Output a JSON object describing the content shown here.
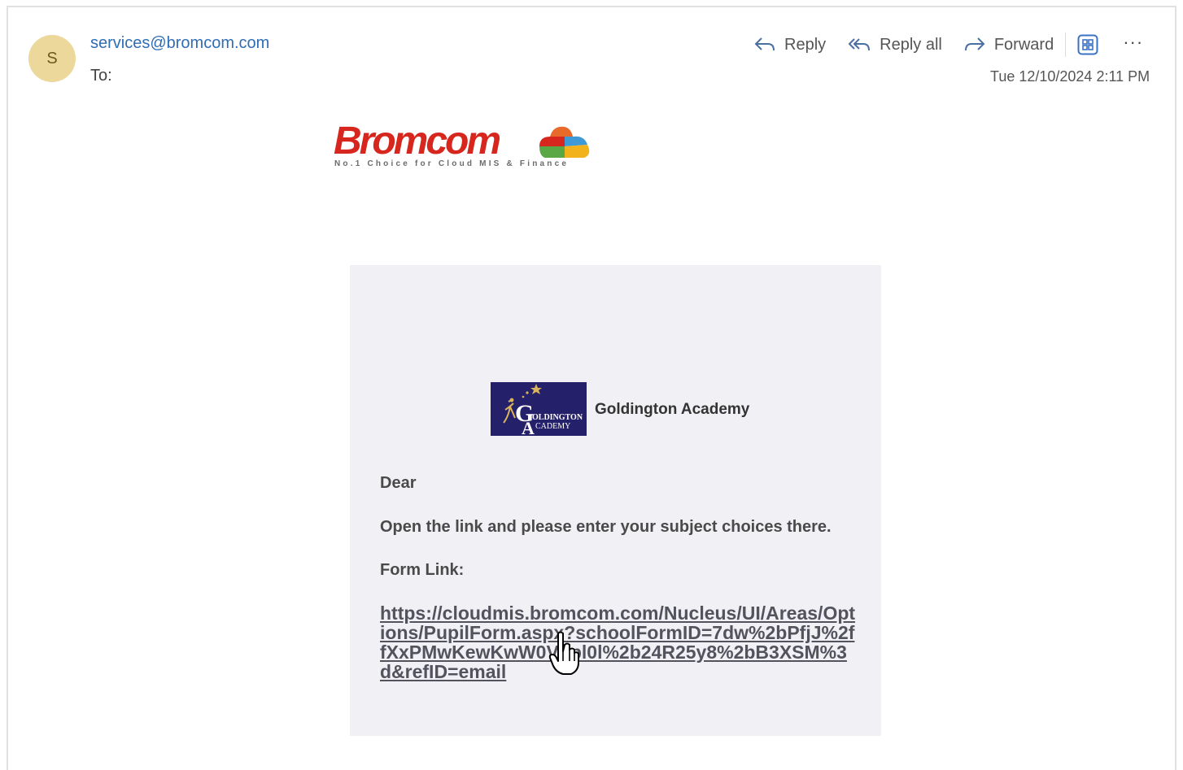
{
  "header": {
    "avatar_initial": "S",
    "sender": "services@bromcom.com",
    "to_label": "To:",
    "date": "Tue 12/10/2024 2:11 PM"
  },
  "actions": {
    "reply": "Reply",
    "reply_all": "Reply all",
    "forward": "Forward",
    "more": "···"
  },
  "logo": {
    "word": "Bromcom",
    "tagline": "No.1 Choice for Cloud MIS & Finance"
  },
  "school": {
    "logo_text": "GOLDINGTON ACADEMY",
    "name": "Goldington Academy"
  },
  "email_body": {
    "greeting": "Dear",
    "message": "Open the link and please enter your subject choices there.",
    "form_link_label": "Form Link:",
    "link": "https://cloudmis.bromcom.com/Nucleus/UI/Areas/Options/PupilForm.aspx?schoolFormID=7dw%2bPfjJ%2ffXxPMwKewKwW0Vdpl0l%2b24R25y8%2bB3XSM%3d&refID=email"
  },
  "colors": {
    "accent": "#2f6db5",
    "avatar": "#ebd89a",
    "bromcom_red": "#d7261e",
    "school_navy": "#24206a",
    "panel_bg": "#f1f1f5"
  }
}
